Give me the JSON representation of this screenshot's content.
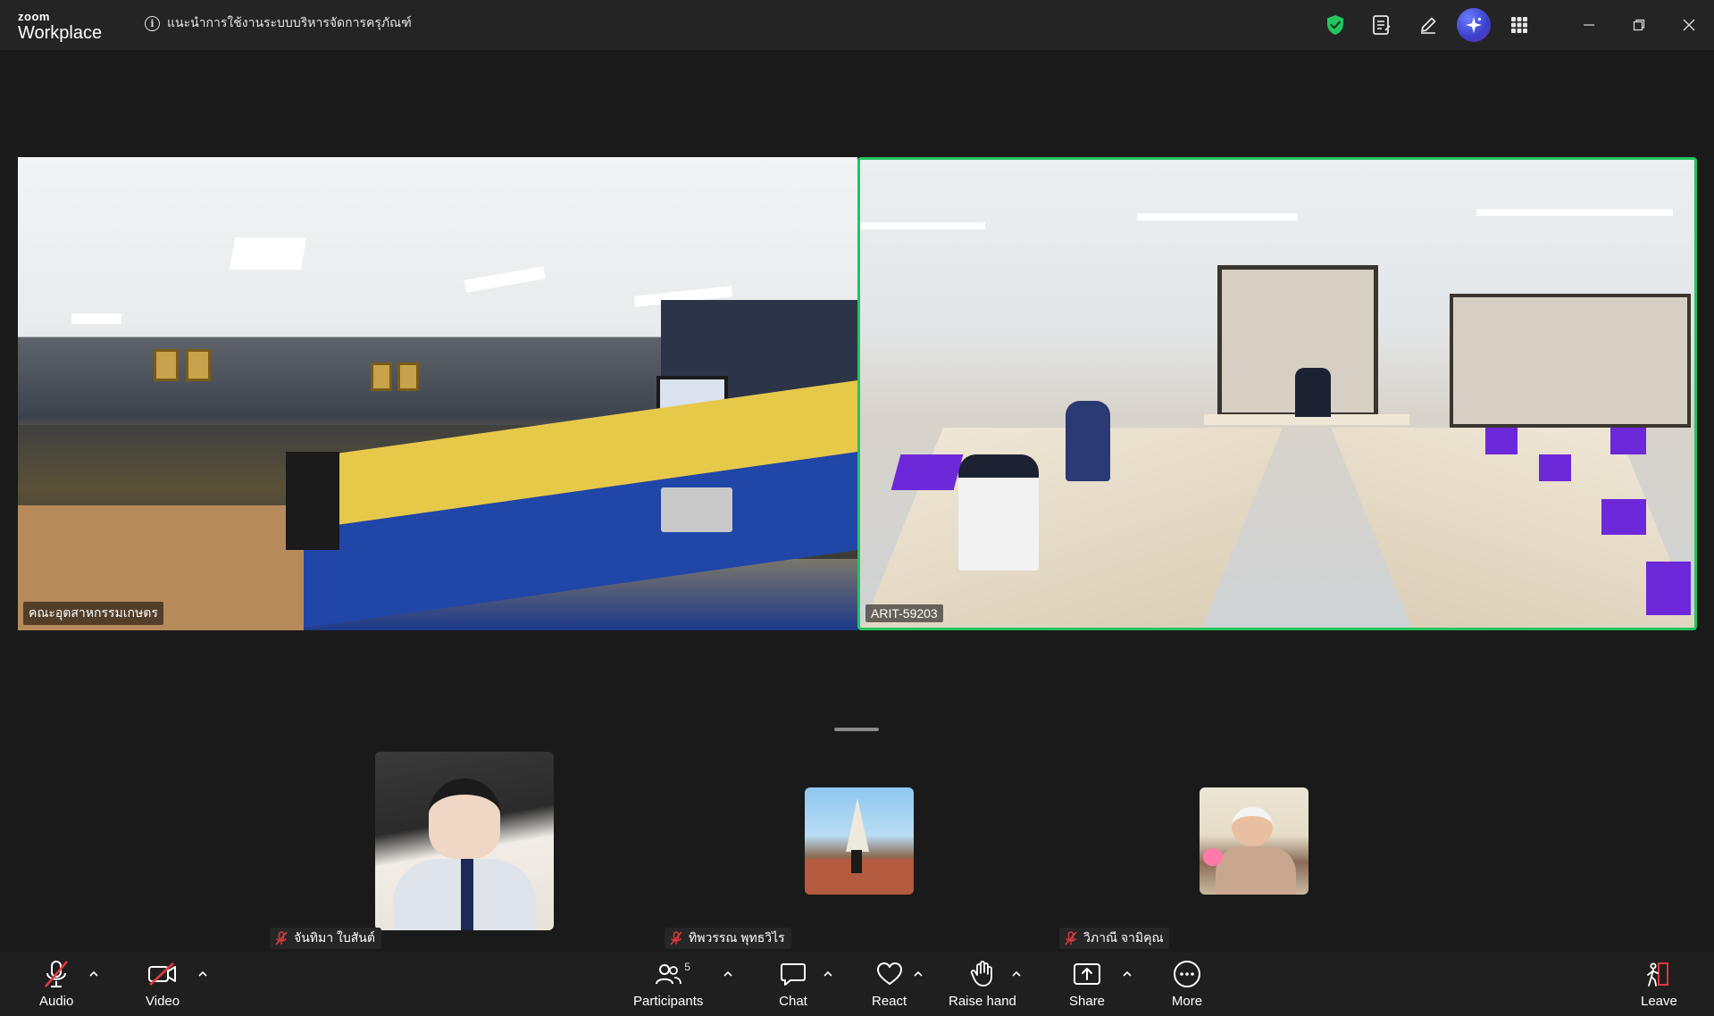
{
  "app": {
    "brand_small": "zoom",
    "brand_large": "Workplace"
  },
  "meeting": {
    "title": "แนะนำการใช้งานระบบบริหารจัดการครุภัณฑ์"
  },
  "colors": {
    "active_speaker": "#22c55e",
    "muted": "#e0393e",
    "ai": "#4b54e6"
  },
  "stage": {
    "left_tile": {
      "name": "คณะอุตสาหกรรมเกษตร"
    },
    "right_tile": {
      "name": "ARIT-59203"
    }
  },
  "thumbnails": [
    {
      "name": "จันทิมา ใบสันต์",
      "muted": true
    },
    {
      "name": "ทิพวรรณ พุทธวิไร",
      "muted": true
    },
    {
      "name": "วิภาณี จามิคุณ",
      "muted": true
    }
  ],
  "toolbar": {
    "audio": "Audio",
    "video": "Video",
    "participants": "Participants",
    "participants_count": "5",
    "chat": "Chat",
    "react": "React",
    "raise_hand": "Raise hand",
    "share": "Share",
    "more": "More",
    "leave": "Leave"
  }
}
